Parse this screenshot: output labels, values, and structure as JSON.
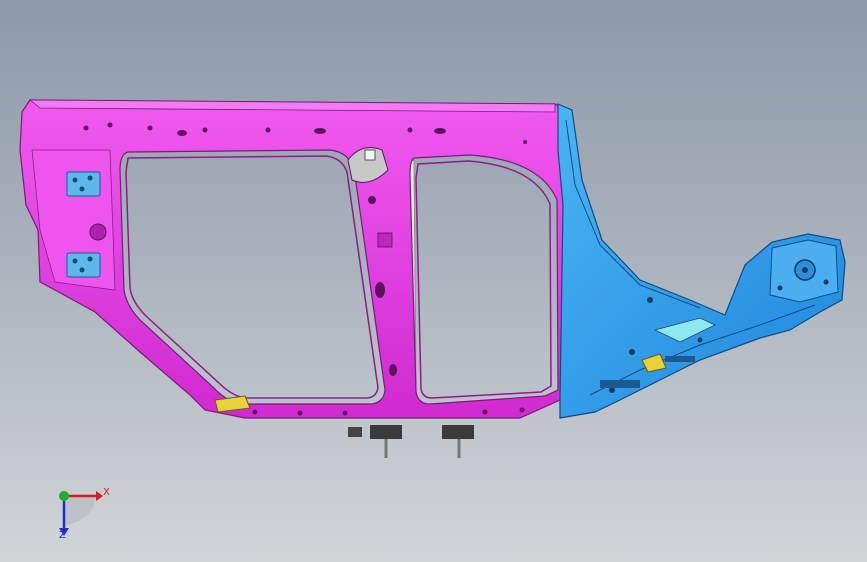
{
  "viewport": {
    "background_top": "#8c9aa9",
    "background_bottom": "#d2d5d8"
  },
  "model": {
    "left_panel_color": "#e637e6",
    "right_panel_color": "#2f9bea",
    "accent_color": "#e8d23a",
    "highlight_color": "#8fe8f0"
  },
  "triad": {
    "x_label": "X",
    "z_label": "Z",
    "x_color": "#d42020",
    "y_color": "#1fae2a",
    "z_color": "#2030c8"
  }
}
